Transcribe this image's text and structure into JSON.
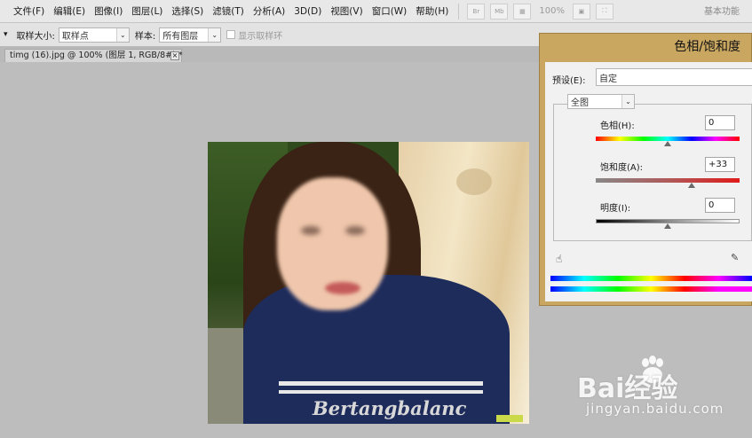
{
  "menu": {
    "items": [
      "文件(F)",
      "编辑(E)",
      "图像(I)",
      "图层(L)",
      "选择(S)",
      "滤镜(T)",
      "分析(A)",
      "3D(D)",
      "视图(V)",
      "窗口(W)",
      "帮助(H)"
    ],
    "tool_br": "Br",
    "tool_mb": "Mb",
    "zoom": "100%",
    "workspace": "基本功能"
  },
  "options": {
    "sample_size_label": "取样大小:",
    "sample_size_value": "取样点",
    "sample_label": "样本:",
    "sample_value": "所有图层",
    "show_ring_label": "显示取样环"
  },
  "document": {
    "tab_title": "timg (16).jpg @ 100% (图层 1, RGB/8#) *",
    "close": "×",
    "shirt_text": "Bertangbalanc"
  },
  "dialog": {
    "title": "色相/饱和度",
    "preset_label": "预设(E):",
    "preset_value": "自定",
    "channel_value": "全图",
    "hue_label": "色相(H):",
    "hue_value": "0",
    "hue_level": 0.5,
    "saturation_label": "饱和度(A):",
    "saturation_value": "+33",
    "saturation_level": 0.665,
    "lightness_label": "明度(I):",
    "lightness_value": "0",
    "lightness_level": 0.5
  },
  "watermark": {
    "brand": "Bai经验",
    "url": "jingyan.baidu.com"
  }
}
